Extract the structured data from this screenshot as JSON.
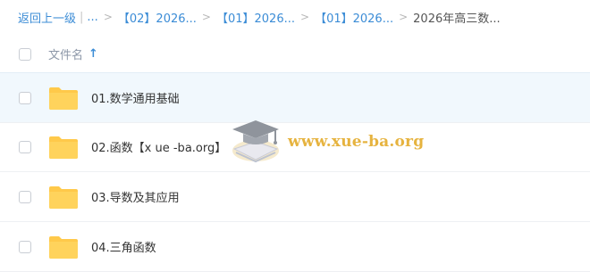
{
  "breadcrumb": {
    "back": "返回上一级",
    "pipe": "|",
    "ellipsis": "...",
    "crumbs": [
      "【02】2026...",
      "【01】2026...",
      "【01】2026..."
    ],
    "current": "2026年高三数..."
  },
  "list": {
    "column_name": "文件名",
    "sort": "ascending",
    "items": [
      {
        "name": "01.数学通用基础",
        "icon": "folder-icon"
      },
      {
        "name": "02.函数【x ue -ba.org】",
        "icon": "folder-icon"
      },
      {
        "name": "03.导数及其应用",
        "icon": "folder-icon"
      },
      {
        "name": "04.三角函数",
        "icon": "folder-icon"
      }
    ]
  },
  "watermark": {
    "text": "www.xue-ba.org"
  },
  "colors": {
    "accent": "#3b8cd6",
    "folder": "#ffc94a",
    "hover_row": "#f1f8fd",
    "watermark": "#e6b33f"
  }
}
